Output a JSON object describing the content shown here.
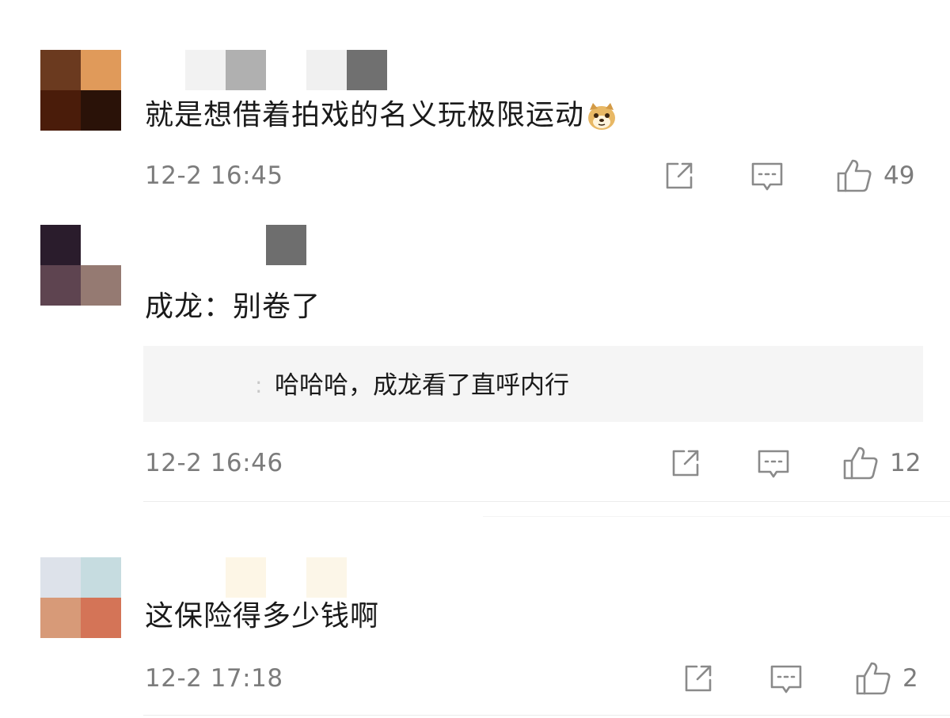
{
  "comments": [
    {
      "text": "就是想借着拍戏的名义玩极限运动",
      "emoji": "doge-emoji",
      "time": "12-2 16:45",
      "likes": "49",
      "avatar_colors": [
        "#6b3a1f",
        "#e09a5a",
        "#4a1c0a",
        "#2a1208"
      ],
      "name_colors": [
        "#ffffff",
        "#f2f2f2",
        "#b0b0b0",
        "#ffffff",
        "#f0f0f0",
        "#707070"
      ]
    },
    {
      "text": "成龙：别卷了",
      "time": "12-2 16:46",
      "likes": "12",
      "reply": {
        "sep": ":",
        "text": "哈哈哈，成龙看了直呼内行"
      },
      "avatar_colors": [
        "#2a1c2c",
        "#ffffff",
        "#5e4450",
        "#957a72"
      ],
      "name_colors": [
        "#ffffff",
        "#ffffff",
        "#ffffff",
        "#6e6e6e"
      ]
    },
    {
      "text": "这保险得多少钱啊",
      "time": "12-2 17:18",
      "likes": "2",
      "avatar_colors": [
        "#dde2ea",
        "#c6dce0",
        "#d79a78",
        "#d47457"
      ],
      "name_colors": [
        "#ffffff",
        "#ffffff",
        "#fdf6e6",
        "#ffffff",
        "#fcf6e8"
      ]
    }
  ],
  "icons": {
    "share": "share-icon",
    "comment": "comment-icon",
    "like": "thumbs-up-icon"
  }
}
